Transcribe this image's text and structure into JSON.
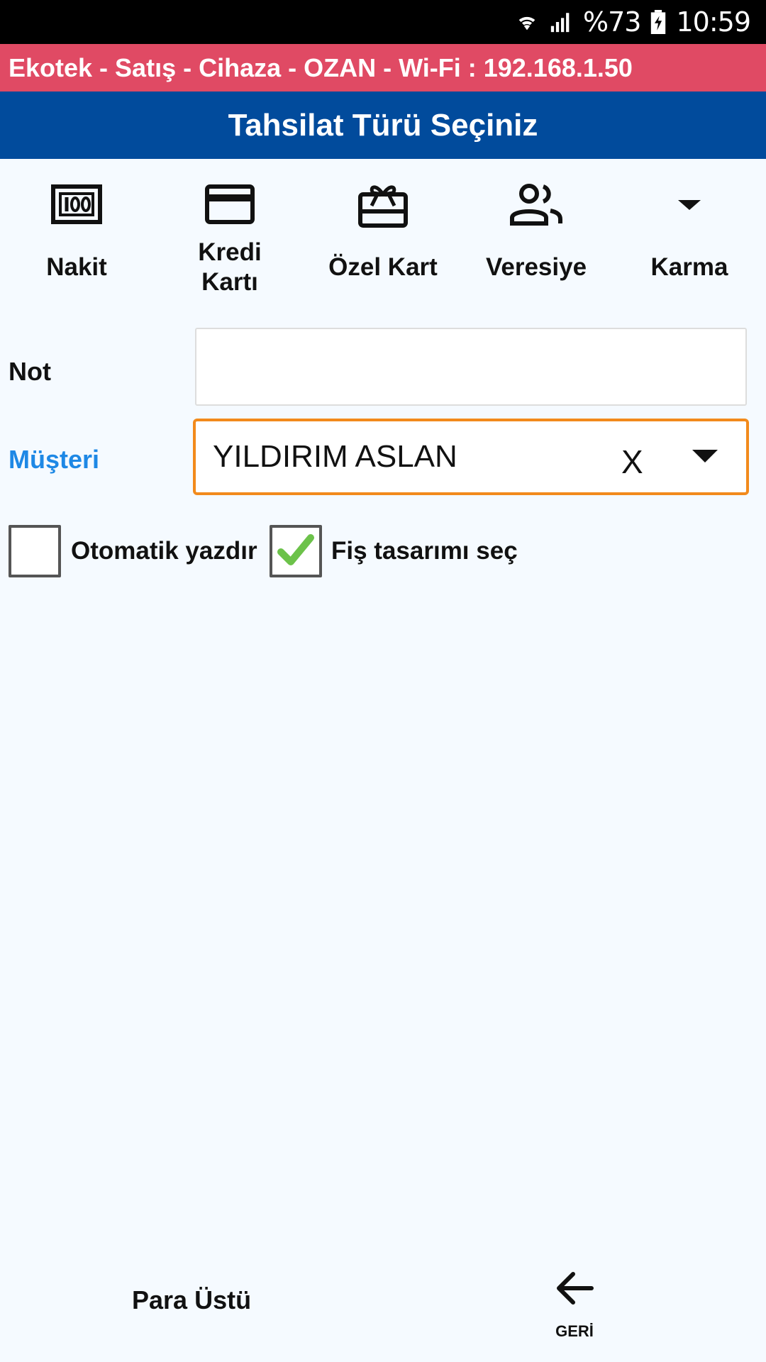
{
  "status_bar": {
    "battery": "%73",
    "time": "10:59",
    "icons": [
      "wifi-icon",
      "signal-icon",
      "battery-icon"
    ]
  },
  "app_header": {
    "text": "Ekotek - Satış - Cihaza - OZAN - Wi-Fi : 192.168.1.50"
  },
  "title": "Tahsilat Türü Seçiniz",
  "payment_types": [
    {
      "label": "Nakit",
      "icon": "cash-icon"
    },
    {
      "label": "Kredi Kartı",
      "icon": "credit-card-icon"
    },
    {
      "label": "Özel Kart",
      "icon": "gift-card-icon"
    },
    {
      "label": "Veresiye",
      "icon": "people-icon"
    },
    {
      "label": "Karma",
      "icon": "caret-down-icon"
    }
  ],
  "form": {
    "note_label": "Not",
    "note_value": "",
    "customer_label": "Müşteri",
    "customer_value": "YILDIRIM ASLAN",
    "clear_label": "X"
  },
  "options": {
    "auto_print_label": "Otomatik yazdır",
    "auto_print_checked": false,
    "receipt_design_label": "Fiş tasarımı seç",
    "receipt_design_checked": true
  },
  "footer": {
    "change_label": "Para Üstü",
    "back_label": "GERİ"
  },
  "colors": {
    "header_red": "#e04a64",
    "title_blue": "#014b9c",
    "customer_label_blue": "#1e88e5",
    "select_border_orange": "#f28a1c",
    "check_green": "#6cc24a"
  }
}
